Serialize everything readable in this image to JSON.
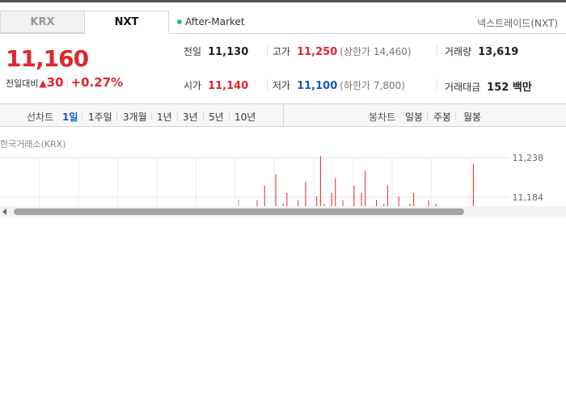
{
  "market_tabs": [
    "KRX",
    "NXT"
  ],
  "session": "After-Market",
  "venue_label": "넥스트레이드(NXT)",
  "price": "11,160",
  "change": {
    "label": "전일대비",
    "arrow": "▲",
    "amount": "30",
    "percent": "+0.27%",
    "color": "#e0262c"
  },
  "stats": {
    "prev_close": {
      "label": "전일",
      "value": "11,130"
    },
    "high": {
      "label": "고가",
      "value": "11,250",
      "sub": "(상한가 14,460)"
    },
    "volume": {
      "label": "거래량",
      "value": "13,619"
    },
    "open": {
      "label": "시가",
      "value": "11,140"
    },
    "low": {
      "label": "저가",
      "value": "11,100",
      "sub": "(하한가 7,800)"
    },
    "amount": {
      "label": "거래대금",
      "value": "152 백만"
    }
  },
  "chart_toolbar": {
    "line_label": "선차트",
    "line_periods": [
      "1일",
      "1주일",
      "3개월",
      "1년",
      "3년",
      "5년",
      "10년"
    ],
    "active_period": "1일",
    "candle_label": "봉차트",
    "candle_periods": [
      "일봉",
      "주봉",
      "월봉"
    ]
  },
  "exchange_label": "한국거래소(KRX)",
  "colors": {
    "up": "#e0262c",
    "down": "#1a56c9",
    "accent_dot": "#2bbf9b"
  },
  "chart_data": {
    "type": "line",
    "ylim_labels": [
      "11,238",
      "11,184"
    ],
    "x": [
      0,
      1,
      2,
      3,
      4,
      5,
      6,
      7,
      8,
      9,
      10,
      11,
      12,
      13,
      14,
      15,
      16,
      17,
      18,
      19,
      20,
      21,
      22,
      23,
      24,
      25,
      26,
      27,
      28,
      29,
      30,
      31,
      32,
      33,
      34,
      35,
      36,
      37,
      38,
      39,
      40,
      41,
      42,
      43,
      44,
      45,
      46,
      47,
      48,
      49,
      50,
      51,
      52,
      53,
      54,
      55,
      56,
      57,
      58,
      59
    ],
    "values": [
      11180,
      11160,
      11200,
      11170,
      11165,
      11215,
      11160,
      11175,
      11190,
      11165,
      11160,
      11180,
      11170,
      11205,
      11165,
      11160,
      11185,
      11240,
      11175,
      11160,
      11190,
      11210,
      11165,
      11180,
      11160,
      11170,
      11200,
      11165,
      11190,
      11220,
      11170,
      11160,
      11180,
      11165,
      11175,
      11200,
      11160,
      11170,
      11185,
      11165,
      11160,
      11175,
      11190,
      11160,
      11170,
      11165,
      11180,
      11160,
      11175,
      11165,
      11160,
      11170,
      11168,
      11162,
      11165,
      11160,
      11163,
      11161,
      11230,
      11160
    ]
  }
}
